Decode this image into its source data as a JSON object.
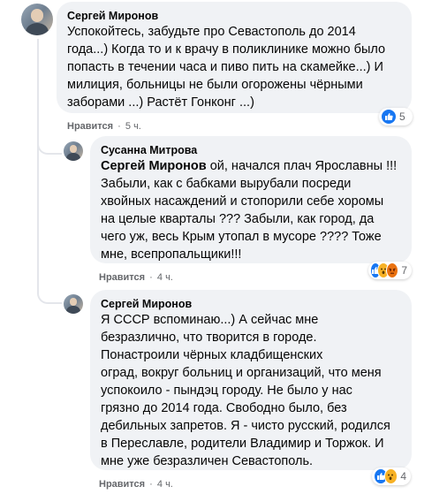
{
  "comments": [
    {
      "author": "Сергей Миронов",
      "text": "Успокойтесь, забудьте про Севастополь до 2014\nгода...) Когда то и к врачу в поликлинике можно было\nпопасть в течении часа и пиво пить на скамейке...) И\nмилиция, больницы не были огорожены чёрными\nзаборами ...) Растёт Гонконг ...)",
      "like_label": "Нравится",
      "time": "5 ч.",
      "reaction_icons": [
        "like-icon"
      ],
      "reaction_count": "5"
    },
    {
      "author": "Сусанна Митрова",
      "mention": "Сергей Миронов",
      "text_after_mention": " ой, начался плач Ярославны !!!",
      "text": "Забыли, как      с бабками вырубали посреди\nхвойных насаждений и стопорили себе хоромы\nна целые кварталы ??? Забыли, как город, да\nчего уж, весь Крым утопал в мусоре ???? Тоже\nмне, всепропальщики!!!",
      "like_label": "Нравится",
      "time": "4 ч.",
      "reaction_icons": [
        "like-icon",
        "wow-icon",
        "angry-icon"
      ],
      "reaction_count": "7"
    },
    {
      "author": "Сергей Миронов",
      "text": "Я СССР вспоминаю...) А сейчас мне\nбезразлично, что творится в городе.\nПонастроили чёрных кладбищенских\nоград, вокруг больниц и организаций, что меня\nуспокоило - пындэц городу. Не было у нас\nгрязно до 2014 года. Свободно было, без\nдебильных запретов. Я - чисто русский, родился\nв Переславле, родители Владимир и Торжок. И\nмне уже безразличен Севастополь.",
      "like_label": "Нравится",
      "time": "4 ч.",
      "reaction_icons": [
        "like-icon",
        "wow-icon"
      ],
      "reaction_count": "4"
    }
  ],
  "separator": "·",
  "colors": {
    "bubble": "#f0f2f5",
    "meta": "#65676b",
    "like": "#1877f2",
    "wow": "#f7b125",
    "angry": "#e9710f"
  }
}
